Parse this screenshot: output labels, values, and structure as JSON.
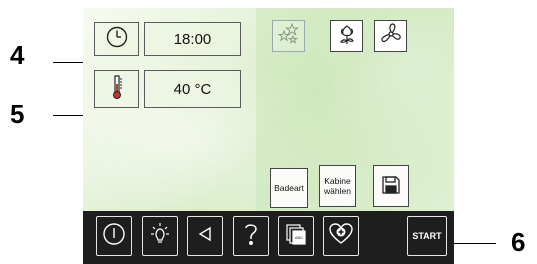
{
  "display": {
    "time": "18:00",
    "temperature": "40 °C"
  },
  "mode_buttons": [
    {
      "name": "sparkle-stars-icon",
      "state": "inactive"
    },
    {
      "name": "flower-icon",
      "state": "active"
    },
    {
      "name": "fan-icon",
      "state": "active"
    }
  ],
  "bottom_buttons": {
    "bath_type": "Badeart",
    "cabin_select_line1": "Kabine",
    "cabin_select_line2": "wählen"
  },
  "toolbar": {
    "icons": [
      "power-icon",
      "light-icon",
      "back-arrow-icon",
      "help-icon",
      "programs-icon",
      "favorites-icon"
    ],
    "start_label": "START"
  },
  "callouts": {
    "c4": "4",
    "c5": "5",
    "c6": "6"
  }
}
